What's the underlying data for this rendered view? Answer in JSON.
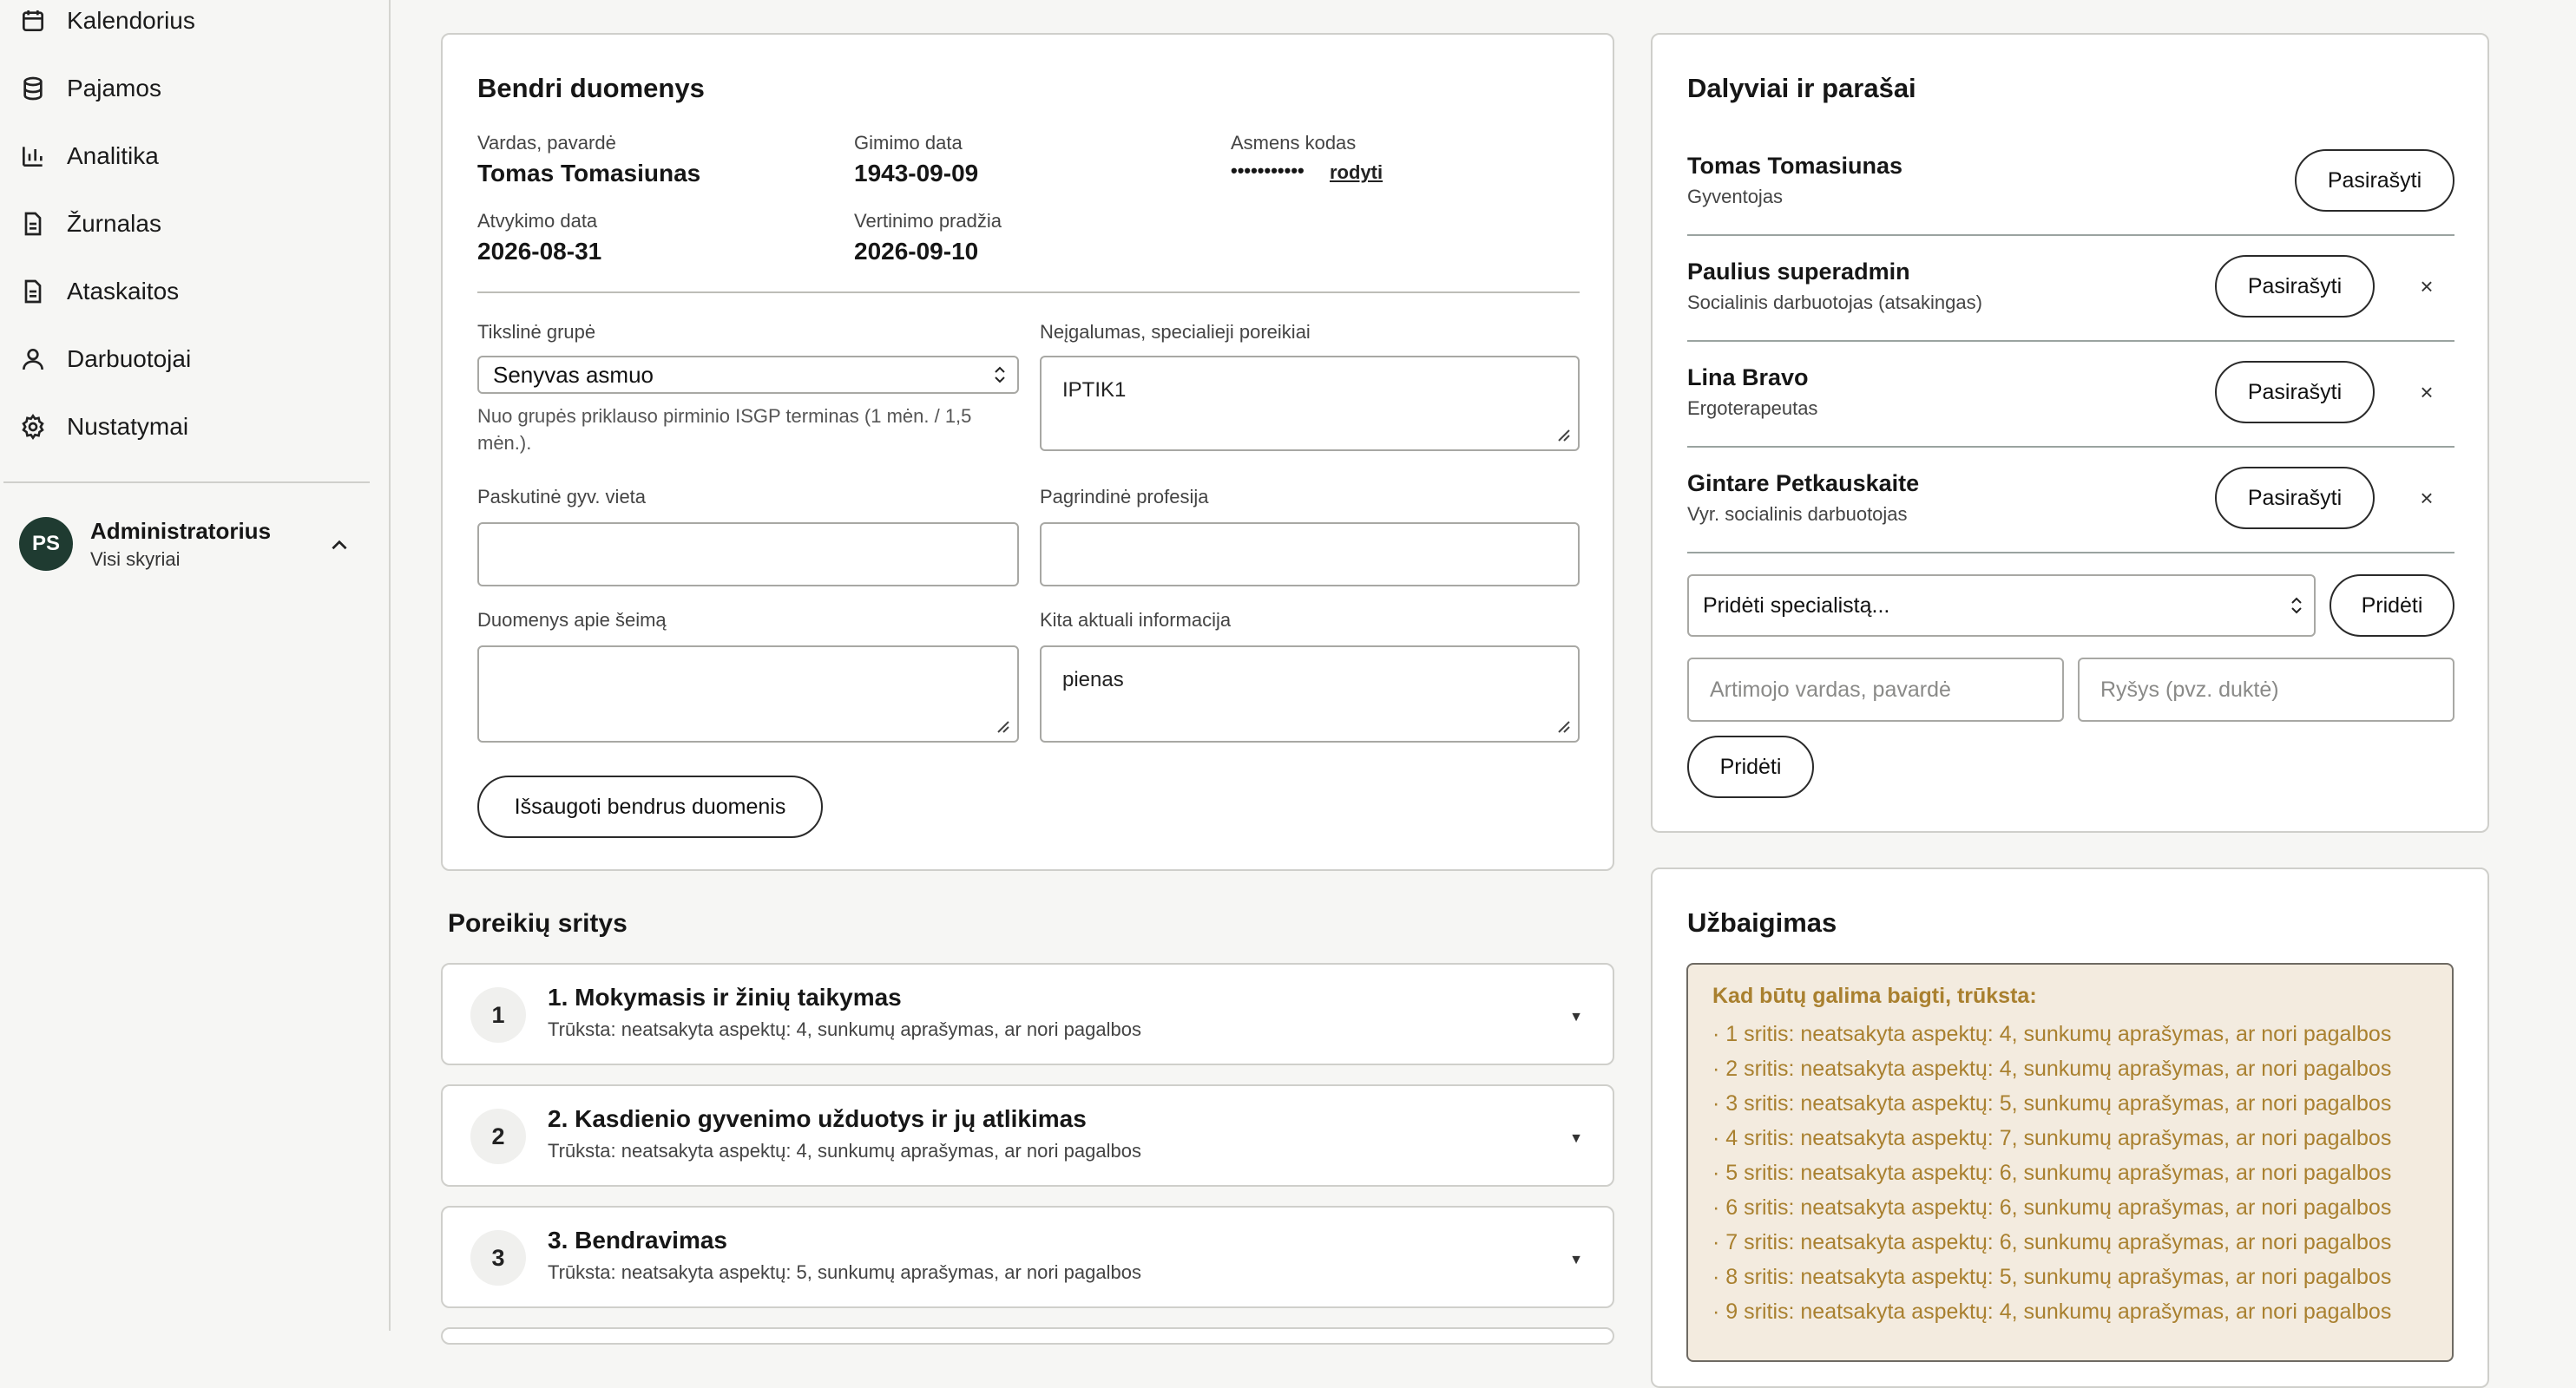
{
  "sidebar": {
    "items": [
      {
        "label": "Kalendorius",
        "icon": "calendar-icon"
      },
      {
        "label": "Pajamos",
        "icon": "database-icon"
      },
      {
        "label": "Analitika",
        "icon": "bar-chart-icon"
      },
      {
        "label": "Žurnalas",
        "icon": "document-icon"
      },
      {
        "label": "Ataskaitos",
        "icon": "document-icon"
      },
      {
        "label": "Darbuotojai",
        "icon": "user-icon"
      },
      {
        "label": "Nustatymai",
        "icon": "gear-icon"
      }
    ],
    "user": {
      "initials": "PS",
      "name": "Administratorius",
      "sub": "Visi skyriai"
    }
  },
  "general": {
    "title": "Bendri duomenys",
    "name_label": "Vardas, pavardė",
    "name_value": "Tomas Tomasiunas",
    "birth_label": "Gimimo data",
    "birth_value": "1943-09-09",
    "code_label": "Asmens kodas",
    "code_value": "•••••••••••",
    "code_link": "rodyti",
    "arrival_label": "Atvykimo data",
    "arrival_value": "2026-08-31",
    "eval_label": "Vertinimo pradžia",
    "eval_value": "2026-09-10",
    "group_label": "Tikslinė grupė",
    "group_value": "Senyvas asmuo",
    "group_hint": "Nuo grupės priklauso pirminio ISGP terminas (1 mėn. / 1,5 mėn.).",
    "disability_label": "Neįgalumas, specialieji poreikiai",
    "disability_value": "IPTIK1",
    "residence_label": "Paskutinė gyv. vieta",
    "residence_value": "",
    "profession_label": "Pagrindinė profesija",
    "profession_value": "",
    "family_label": "Duomenys apie šeimą",
    "family_value": "",
    "other_label": "Kita aktuali informacija",
    "other_value": "pienas",
    "save_label": "Išsaugoti bendrus duomenis"
  },
  "needs": {
    "title": "Poreikių sritys",
    "items": [
      {
        "num": "1",
        "title": "1. Mokymasis ir žinių taikymas",
        "sub": "Trūksta: neatsakyta aspektų: 4, sunkumų aprašymas, ar nori pagalbos"
      },
      {
        "num": "2",
        "title": "2. Kasdienio gyvenimo užduotys ir jų atlikimas",
        "sub": "Trūksta: neatsakyta aspektų: 4, sunkumų aprašymas, ar nori pagalbos"
      },
      {
        "num": "3",
        "title": "3. Bendravimas",
        "sub": "Trūksta: neatsakyta aspektų: 5, sunkumų aprašymas, ar nori pagalbos"
      }
    ]
  },
  "participants": {
    "title": "Dalyviai ir parašai",
    "sign_label": "Pasirašyti",
    "remove_label": "×",
    "people": [
      {
        "name": "Tomas Tomasiunas",
        "role": "Gyventojas"
      },
      {
        "name": "Paulius superadmin",
        "role": "Socialinis darbuotojas (atsakingas)"
      },
      {
        "name": "Lina Bravo",
        "role": "Ergoterapeutas"
      },
      {
        "name": "Gintare Petkauskaite",
        "role": "Vyr. socialinis darbuotojas"
      }
    ],
    "add_specialist_value": "Pridėti specialistą...",
    "add_label": "Pridėti",
    "relative_placeholder": "Artimojo vardas, pavardė",
    "relation_placeholder": "Ryšys (pvz. duktė)"
  },
  "completion": {
    "title": "Užbaigimas",
    "warn_title": "Kad būtų galima baigti, trūksta:",
    "lines": [
      "· 1 sritis: neatsakyta aspektų: 4, sunkumų aprašymas, ar nori pagalbos",
      "· 2 sritis: neatsakyta aspektų: 4, sunkumų aprašymas, ar nori pagalbos",
      "· 3 sritis: neatsakyta aspektų: 5, sunkumų aprašymas, ar nori pagalbos",
      "· 4 sritis: neatsakyta aspektų: 7, sunkumų aprašymas, ar nori pagalbos",
      "· 5 sritis: neatsakyta aspektų: 6, sunkumų aprašymas, ar nori pagalbos",
      "· 6 sritis: neatsakyta aspektų: 6, sunkumų aprašymas, ar nori pagalbos",
      "· 7 sritis: neatsakyta aspektų: 6, sunkumų aprašymas, ar nori pagalbos",
      "· 8 sritis: neatsakyta aspektų: 5, sunkumų aprašymas, ar nori pagalbos",
      "· 9 sritis: neatsakyta aspektų: 4, sunkumų aprašymas, ar nori pagalbos"
    ]
  }
}
